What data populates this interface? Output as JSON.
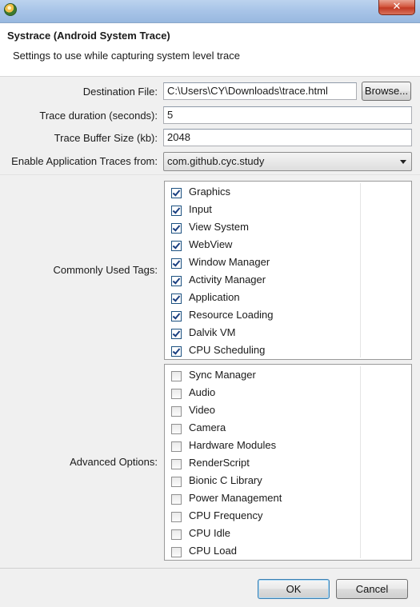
{
  "window": {
    "close_glyph": "✕"
  },
  "header": {
    "title": "Systrace (Android System Trace)",
    "subtitle": "Settings to use while capturing system level trace"
  },
  "form": {
    "destination_label": "Destination File:",
    "destination_value": "C:\\Users\\CY\\Downloads\\trace.html",
    "browse_label": "Browse...",
    "duration_label": "Trace duration (seconds):",
    "duration_value": "5",
    "buffer_label": "Trace Buffer Size (kb):",
    "buffer_value": "2048",
    "app_traces_label": "Enable Application Traces from:",
    "app_traces_value": "com.github.cyc.study"
  },
  "common_tags": {
    "label": "Commonly Used Tags:",
    "items": [
      {
        "label": "Graphics",
        "checked": true
      },
      {
        "label": "Input",
        "checked": true
      },
      {
        "label": "View System",
        "checked": true
      },
      {
        "label": "WebView",
        "checked": true
      },
      {
        "label": "Window Manager",
        "checked": true
      },
      {
        "label": "Activity Manager",
        "checked": true
      },
      {
        "label": "Application",
        "checked": true
      },
      {
        "label": "Resource Loading",
        "checked": true
      },
      {
        "label": "Dalvik VM",
        "checked": true
      },
      {
        "label": "CPU Scheduling",
        "checked": true
      }
    ]
  },
  "advanced_tags": {
    "label": "Advanced Options:",
    "items": [
      {
        "label": "Sync Manager",
        "checked": false
      },
      {
        "label": "Audio",
        "checked": false
      },
      {
        "label": "Video",
        "checked": false
      },
      {
        "label": "Camera",
        "checked": false
      },
      {
        "label": "Hardware Modules",
        "checked": false
      },
      {
        "label": "RenderScript",
        "checked": false
      },
      {
        "label": "Bionic C Library",
        "checked": false
      },
      {
        "label": "Power Management",
        "checked": false
      },
      {
        "label": "CPU Frequency",
        "checked": false
      },
      {
        "label": "CPU Idle",
        "checked": false
      },
      {
        "label": "CPU Load",
        "checked": false
      }
    ]
  },
  "buttons": {
    "ok": "OK",
    "cancel": "Cancel"
  }
}
